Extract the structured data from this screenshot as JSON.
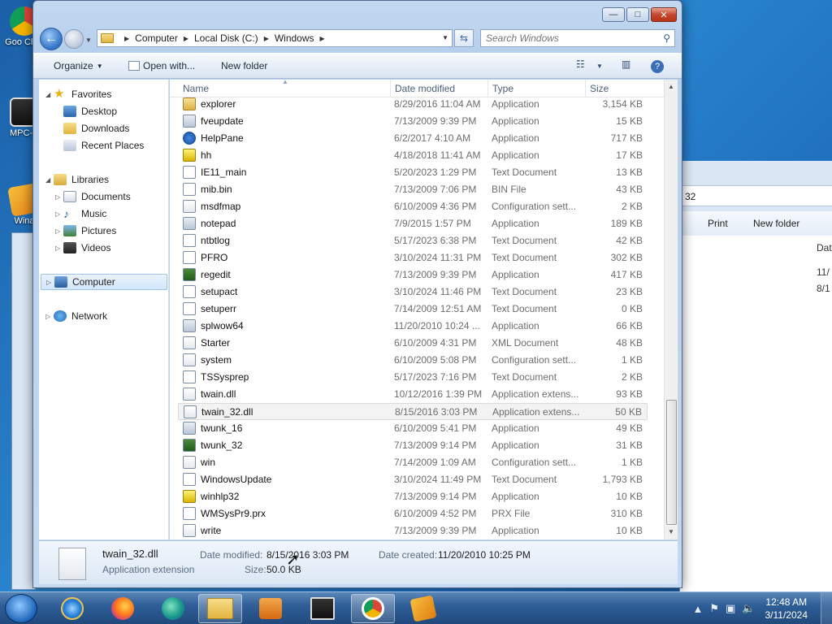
{
  "desktop": {
    "icons": [
      {
        "label": "Goo Chro"
      },
      {
        "label": "MPC-H"
      },
      {
        "label": "Wina"
      }
    ]
  },
  "window": {
    "caption_buttons": {
      "minimize": "—",
      "maximize": "□",
      "close": "✕"
    },
    "address": {
      "crumbs": [
        "Computer",
        "Local Disk (C:)",
        "Windows"
      ]
    },
    "search": {
      "placeholder": "Search Windows"
    },
    "commands": {
      "organize": "Organize",
      "open_with": "Open with...",
      "new_folder": "New folder"
    },
    "nav": {
      "favorites": "Favorites",
      "desktop": "Desktop",
      "downloads": "Downloads",
      "recent": "Recent Places",
      "libraries": "Libraries",
      "documents": "Documents",
      "music": "Music",
      "pictures": "Pictures",
      "videos": "Videos",
      "computer": "Computer",
      "network": "Network"
    },
    "columns": {
      "name": "Name",
      "date": "Date modified",
      "type": "Type",
      "size": "Size"
    },
    "files": [
      {
        "name": "explorer",
        "date": "8/29/2016 11:04 AM",
        "type": "Application",
        "size": "3,154 KB",
        "icon": "folderish"
      },
      {
        "name": "fveupdate",
        "date": "7/13/2009 9:39 PM",
        "type": "Application",
        "size": "15 KB",
        "icon": "app"
      },
      {
        "name": "HelpPane",
        "date": "6/2/2017 4:10 AM",
        "type": "Application",
        "size": "717 KB",
        "icon": "help"
      },
      {
        "name": "hh",
        "date": "4/18/2018 11:41 AM",
        "type": "Application",
        "size": "17 KB",
        "icon": "q"
      },
      {
        "name": "IE11_main",
        "date": "5/20/2023 1:29 PM",
        "type": "Text Document",
        "size": "13 KB",
        "icon": "txt"
      },
      {
        "name": "mib.bin",
        "date": "7/13/2009 7:06 PM",
        "type": "BIN File",
        "size": "43 KB",
        "icon": "txt"
      },
      {
        "name": "msdfmap",
        "date": "6/10/2009 4:36 PM",
        "type": "Configuration sett...",
        "size": "2 KB",
        "icon": "dll"
      },
      {
        "name": "notepad",
        "date": "7/9/2015 1:57 PM",
        "type": "Application",
        "size": "189 KB",
        "icon": "app"
      },
      {
        "name": "ntbtlog",
        "date": "5/17/2023 6:38 PM",
        "type": "Text Document",
        "size": "42 KB",
        "icon": "txt"
      },
      {
        "name": "PFRO",
        "date": "3/10/2024 11:31 PM",
        "type": "Text Document",
        "size": "302 KB",
        "icon": "txt"
      },
      {
        "name": "regedit",
        "date": "7/13/2009 9:39 PM",
        "type": "Application",
        "size": "417 KB",
        "icon": "green"
      },
      {
        "name": "setupact",
        "date": "3/10/2024 11:46 PM",
        "type": "Text Document",
        "size": "23 KB",
        "icon": "txt"
      },
      {
        "name": "setuperr",
        "date": "7/14/2009 12:51 AM",
        "type": "Text Document",
        "size": "0 KB",
        "icon": "txt"
      },
      {
        "name": "splwow64",
        "date": "11/20/2010 10:24 ...",
        "type": "Application",
        "size": "66 KB",
        "icon": "app"
      },
      {
        "name": "Starter",
        "date": "6/10/2009 4:31 PM",
        "type": "XML Document",
        "size": "48 KB",
        "icon": "dll"
      },
      {
        "name": "system",
        "date": "6/10/2009 5:08 PM",
        "type": "Configuration sett...",
        "size": "1 KB",
        "icon": "dll"
      },
      {
        "name": "TSSysprep",
        "date": "5/17/2023 7:16 PM",
        "type": "Text Document",
        "size": "2 KB",
        "icon": "txt"
      },
      {
        "name": "twain.dll",
        "date": "10/12/2016 1:39 PM",
        "type": "Application extens...",
        "size": "93 KB",
        "icon": "dll"
      },
      {
        "name": "twain_32.dll",
        "date": "8/15/2016 3:03 PM",
        "type": "Application extens...",
        "size": "50 KB",
        "icon": "dll",
        "selected": true
      },
      {
        "name": "twunk_16",
        "date": "6/10/2009 5:41 PM",
        "type": "Application",
        "size": "49 KB",
        "icon": "app"
      },
      {
        "name": "twunk_32",
        "date": "7/13/2009 9:14 PM",
        "type": "Application",
        "size": "31 KB",
        "icon": "green"
      },
      {
        "name": "win",
        "date": "7/14/2009 1:09 AM",
        "type": "Configuration sett...",
        "size": "1 KB",
        "icon": "dll"
      },
      {
        "name": "WindowsUpdate",
        "date": "3/10/2024 11:49 PM",
        "type": "Text Document",
        "size": "1,793 KB",
        "icon": "txt"
      },
      {
        "name": "winhlp32",
        "date": "7/13/2009 9:14 PM",
        "type": "Application",
        "size": "10 KB",
        "icon": "q"
      },
      {
        "name": "WMSysPr9.prx",
        "date": "6/10/2009 4:52 PM",
        "type": "PRX File",
        "size": "310 KB",
        "icon": "txt"
      },
      {
        "name": "write",
        "date": "7/13/2009 9:39 PM",
        "type": "Application",
        "size": "10 KB",
        "icon": "dll"
      }
    ],
    "details": {
      "filename": "twain_32.dll",
      "filetype": "Application extension",
      "date_modified_label": "Date modified:",
      "date_modified": "8/15/2016 3:03 PM",
      "date_created_label": "Date created:",
      "date_created": "11/20/2010 10:25 PM",
      "size_label": "Size:",
      "size": "50.0 KB"
    }
  },
  "background_window": {
    "address_fragment": "32",
    "print": "Print",
    "new_folder": "New folder",
    "col_fragment": "Dat",
    "row_fragments": [
      "11/",
      "8/1"
    ]
  },
  "taskbar": {
    "apps": [
      "internet-explorer",
      "firefox",
      "edge",
      "file-explorer",
      "media-player",
      "media-player-classic",
      "chrome",
      "winamp"
    ],
    "clock": {
      "time": "12:48 AM",
      "date": "3/11/2024"
    }
  },
  "colors": {
    "selection": "#d3e6fb",
    "taskbar": "#2f5f98",
    "desktop": "#1f6fbf"
  }
}
